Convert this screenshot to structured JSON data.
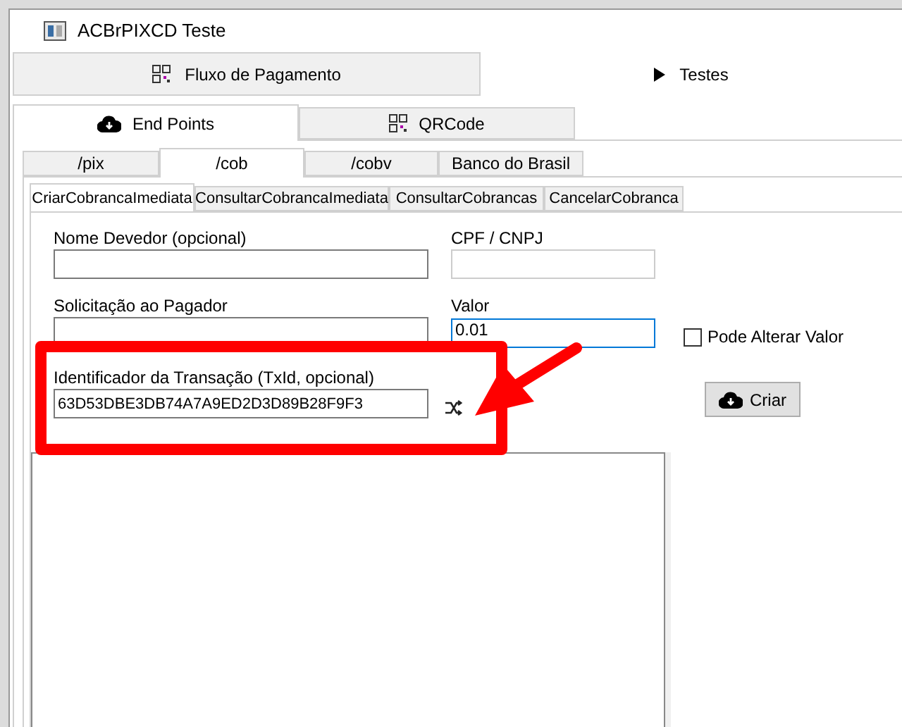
{
  "window": {
    "title": "ACBrPIXCD Teste"
  },
  "main_tabs": [
    {
      "label": "Fluxo de Pagamento",
      "selected": false
    },
    {
      "label": "Testes",
      "selected": true
    }
  ],
  "section_tabs": [
    {
      "label": "End Points",
      "selected": true
    },
    {
      "label": "QRCode",
      "selected": false
    }
  ],
  "endpoint_tabs": [
    {
      "label": "/pix",
      "selected": false
    },
    {
      "label": "/cob",
      "selected": true
    },
    {
      "label": "/cobv",
      "selected": false
    },
    {
      "label": "Banco do Brasil",
      "selected": false
    }
  ],
  "action_tabs": [
    {
      "label": "CriarCobrancaImediata",
      "selected": true
    },
    {
      "label": "ConsultarCobrancaImediata",
      "selected": false
    },
    {
      "label": "ConsultarCobrancas",
      "selected": false
    },
    {
      "label": "CancelarCobranca",
      "selected": false
    }
  ],
  "form": {
    "nome_devedor": {
      "label": "Nome Devedor (opcional)"
    },
    "cpf_cnpj": {
      "label": "CPF / CNPJ",
      "disabled": true
    },
    "solicitacao": {
      "label": "Solicitação ao Pagador"
    },
    "valor": {
      "label": "Valor",
      "value": "0.01",
      "focused": true
    },
    "pode_alterar_valor": {
      "label": "Pode Alterar Valor",
      "checked": false
    },
    "txid": {
      "label": "Identificador da Transação (TxId, opcional)",
      "value": "63D53DBE3DB74A7A9ED2D3D89B28F9F3"
    },
    "criar_button": {
      "label": "Criar"
    }
  }
}
